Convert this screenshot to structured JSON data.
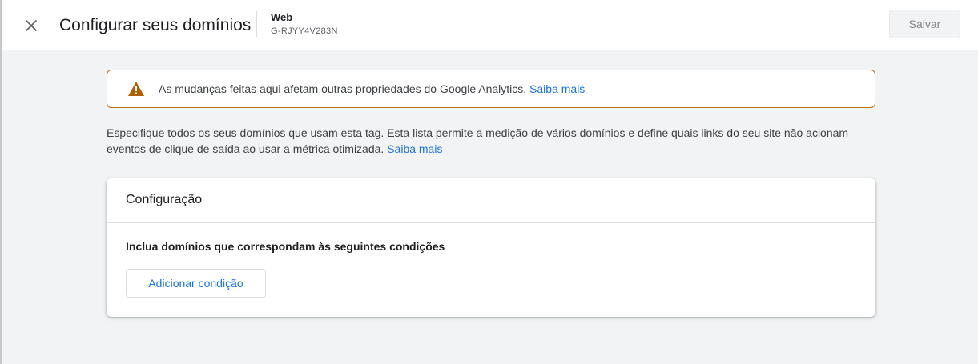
{
  "header": {
    "title": "Configurar seus domínios",
    "stream_name": "Web",
    "stream_id": "G-RJYY4V283N",
    "save_label": "Salvar",
    "close_icon": "close-icon"
  },
  "warning": {
    "icon": "warning-triangle-icon",
    "icon_color": "#b06000",
    "border_color": "#c06a1a",
    "text": "As mudanças feitas aqui afetam outras propriedades do Google Analytics.",
    "link": "Saiba mais"
  },
  "description": {
    "text": "Especifique todos os seus domínios que usam esta tag. Esta lista permite a medição de vários domínios e define quais links do seu site não acionam eventos de clique de saída ao usar a métrica otimizada.",
    "link": "Saiba mais"
  },
  "config_card": {
    "title": "Configuração",
    "condition_label": "Inclua domínios que correspondam às seguintes condições",
    "add_condition_label": "Adicionar condição"
  },
  "colors": {
    "accent": "#1a73e8",
    "background": "#f1f3f4"
  }
}
